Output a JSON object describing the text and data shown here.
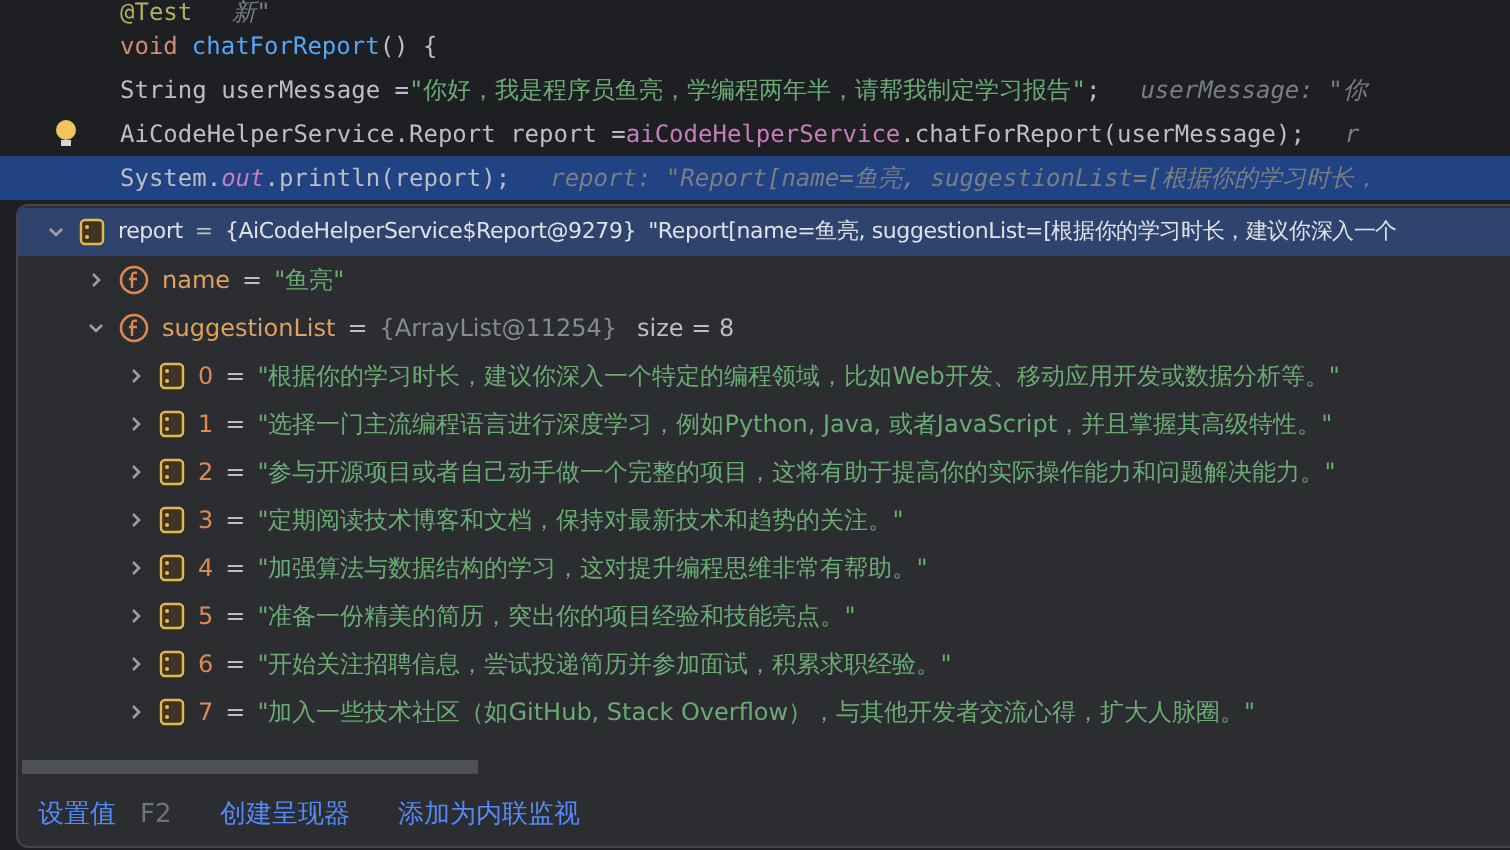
{
  "code_lines": [
    {
      "selected": false,
      "intention_bulb": false,
      "tokens": [
        {
          "kind": "annotation",
          "text": "@Test"
        },
        {
          "kind": "hint",
          "text": "新\""
        }
      ]
    },
    {
      "selected": false,
      "intention_bulb": false,
      "tokens": [
        {
          "kind": "keyword",
          "text": "void"
        },
        {
          "kind": "method",
          "text": "chatForReport"
        },
        {
          "kind": "plain",
          "text": "() {"
        }
      ]
    },
    {
      "selected": false,
      "intention_bulb": false,
      "tokens": [
        {
          "kind": "plain",
          "text": "    String userMessage = "
        },
        {
          "kind": "string",
          "text": "\"你好，我是程序员鱼亮，学编程两年半，请帮我制定学习报告\""
        },
        {
          "kind": "plain",
          "text": ";"
        },
        {
          "kind": "hint",
          "text": "userMessage: \"你"
        }
      ]
    },
    {
      "selected": false,
      "intention_bulb": true,
      "tokens": [
        {
          "kind": "plain",
          "text": "    AiCodeHelperService.Report report = "
        },
        {
          "kind": "field",
          "text": "aiCodeHelperService"
        },
        {
          "kind": "plain",
          "text": ".chatForReport(userMessage);"
        },
        {
          "kind": "hint",
          "text": "r"
        }
      ]
    },
    {
      "selected": true,
      "intention_bulb": false,
      "tokens": [
        {
          "kind": "plain",
          "text": "    System."
        },
        {
          "kind": "static",
          "text": "out"
        },
        {
          "kind": "plain",
          "text": ".println(report);"
        },
        {
          "kind": "hint",
          "text": "report: \"Report[name=鱼亮, suggestionList=[根据你的学习时长，"
        }
      ]
    }
  ],
  "debug_popup": {
    "tree": [
      {
        "kind": "object",
        "name": "report",
        "equals": "=",
        "type": "{AiCodeHelperService$Report@9279}",
        "value": "\"Report[name=鱼亮, suggestionList=[根据你的学习时长，建议你深入一个",
        "expanded": true,
        "selected": true,
        "children": [
          {
            "kind": "field",
            "name": "name",
            "equals": "=",
            "value": "\"鱼亮\"",
            "expanded": false,
            "selected": false
          },
          {
            "kind": "field",
            "name": "suggestionList",
            "equals": "=",
            "type": "{ArrayList@11254}",
            "extra": "size = 8",
            "expanded": true,
            "selected": false,
            "children": [
              {
                "kind": "item",
                "name": "0",
                "equals": "=",
                "value": "\"根据你的学习时长，建议你深入一个特定的编程领域，比如Web开发、移动应用开发或数据分析等。\"",
                "expanded": false,
                "selected": false
              },
              {
                "kind": "item",
                "name": "1",
                "equals": "=",
                "value": "\"选择一门主流编程语言进行深度学习，例如Python, Java, 或者JavaScript，并且掌握其高级特性。\"",
                "expanded": false,
                "selected": false
              },
              {
                "kind": "item",
                "name": "2",
                "equals": "=",
                "value": "\"参与开源项目或者自己动手做一个完整的项目，这将有助于提高你的实际操作能力和问题解决能力。\"",
                "expanded": false,
                "selected": false
              },
              {
                "kind": "item",
                "name": "3",
                "equals": "=",
                "value": "\"定期阅读技术博客和文档，保持对最新技术和趋势的关注。\"",
                "expanded": false,
                "selected": false
              },
              {
                "kind": "item",
                "name": "4",
                "equals": "=",
                "value": "\"加强算法与数据结构的学习，这对提升编程思维非常有帮助。\"",
                "expanded": false,
                "selected": false
              },
              {
                "kind": "item",
                "name": "5",
                "equals": "=",
                "value": "\"准备一份精美的简历，突出你的项目经验和技能亮点。\"",
                "expanded": false,
                "selected": false
              },
              {
                "kind": "item",
                "name": "6",
                "equals": "=",
                "value": "\"开始关注招聘信息，尝试投递简历并参加面试，积累求职经验。\"",
                "expanded": false,
                "selected": false
              },
              {
                "kind": "item",
                "name": "7",
                "equals": "=",
                "value": "\"加入一些技术社区（如GitHub, Stack Overflow），与其他开发者交流心得，扩大人脉圈。\"",
                "expanded": false,
                "selected": false
              }
            ]
          }
        ]
      }
    ],
    "actions": [
      {
        "label": "设置值",
        "shortcut": "F2"
      },
      {
        "label": "创建呈现器"
      },
      {
        "label": "添加为内联监视"
      }
    ]
  }
}
